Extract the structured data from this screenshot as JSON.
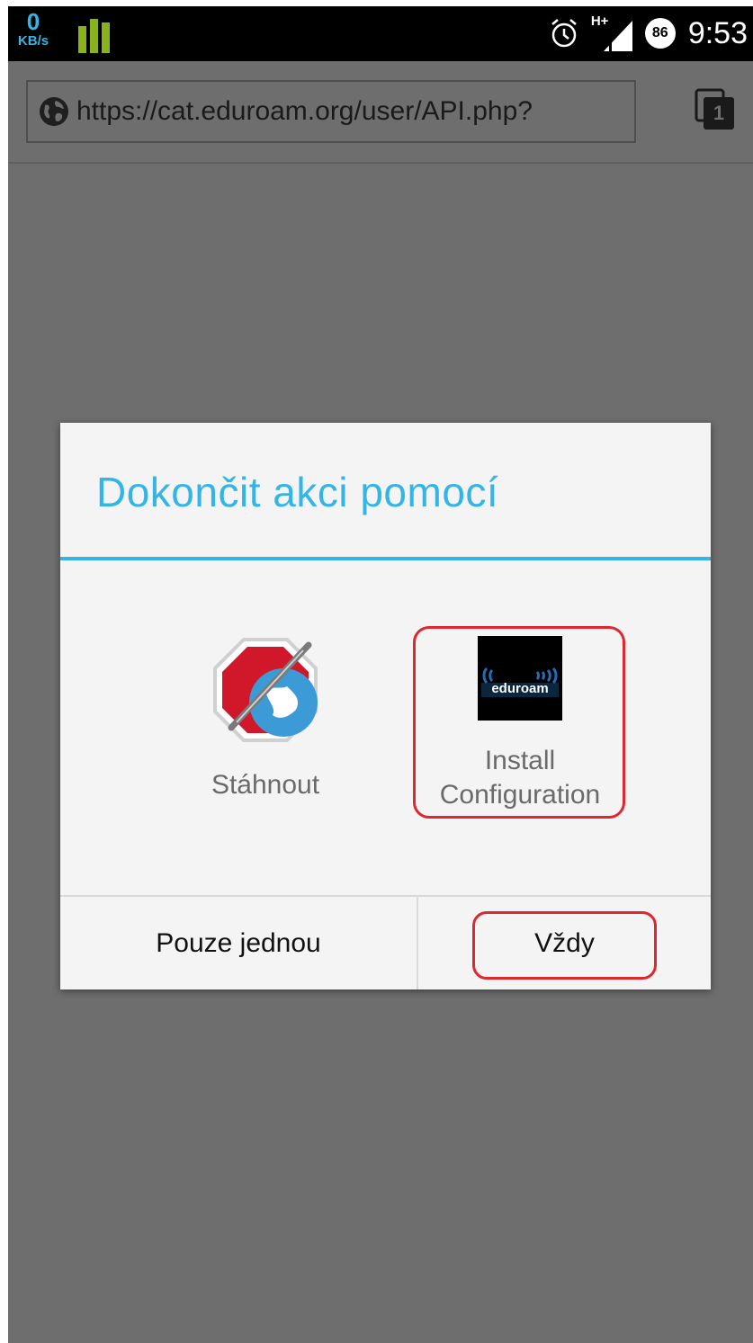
{
  "status_bar": {
    "speed_value": "0",
    "speed_unit": "KB/s",
    "network_type": "H+",
    "battery_level": "86",
    "time": "9:53",
    "icons": [
      "data-usage-icon",
      "alarm-icon",
      "signal-icon",
      "battery-icon"
    ]
  },
  "browser": {
    "url": "https://cat.eduroam.org/user/API.php?",
    "tab_count": "1",
    "icons": [
      "globe-icon",
      "tabs-icon"
    ]
  },
  "dialog": {
    "title": "Dokončit akci pomocí",
    "apps": [
      {
        "label": "Stáhnout",
        "icon": "adblock-browser-icon"
      },
      {
        "label_line1": "Install",
        "label_line2": "Configuration",
        "icon": "eduroam-icon",
        "icon_text": "eduroam"
      }
    ],
    "buttons": {
      "once": "Pouze jednou",
      "always": "Vždy"
    }
  },
  "colors": {
    "accent": "#33b5e5",
    "highlight": "#e0262f",
    "backdrop": "#6e6e6e"
  }
}
